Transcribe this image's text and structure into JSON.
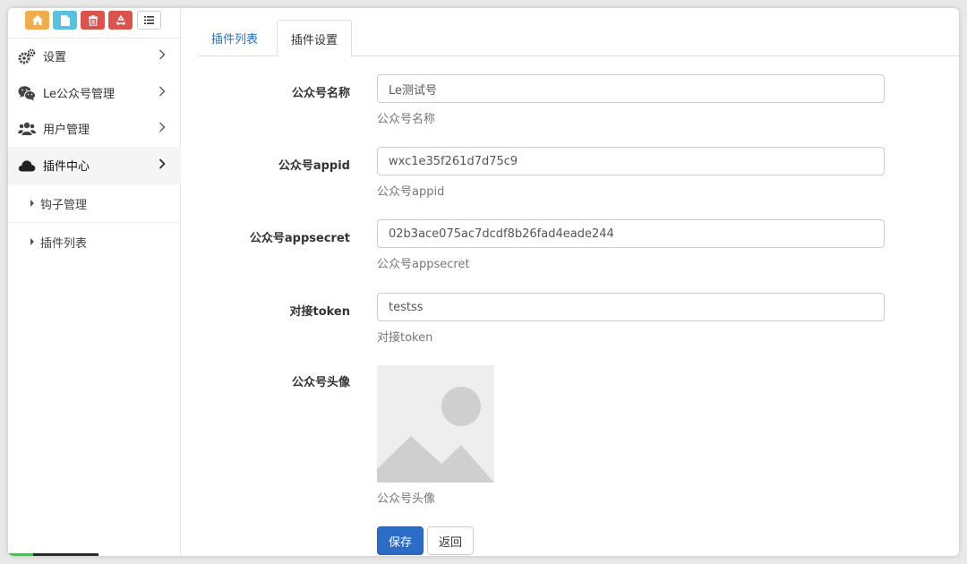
{
  "toolbar": {
    "buttons": [
      {
        "icon": "home-icon",
        "color": "#f0ad4e"
      },
      {
        "icon": "file-icon",
        "color": "#5bc0de"
      },
      {
        "icon": "trash-icon",
        "color": "#d9534f"
      },
      {
        "icon": "recycle-icon",
        "color": "#d9534f"
      },
      {
        "icon": "list-icon",
        "color": "#ffffff"
      }
    ]
  },
  "sidebar": {
    "items": [
      {
        "label": "设置",
        "icon": "gears-icon"
      },
      {
        "label": "Le公众号管理",
        "icon": "wechat-icon"
      },
      {
        "label": "用户管理",
        "icon": "users-icon"
      },
      {
        "label": "插件中心",
        "icon": "cloud-icon",
        "active": true
      }
    ],
    "sub_items": [
      {
        "label": "钩子管理"
      },
      {
        "label": "插件列表"
      }
    ]
  },
  "tabs": [
    {
      "label": "插件列表",
      "active": false
    },
    {
      "label": "插件设置",
      "active": true
    }
  ],
  "form": {
    "name": {
      "label": "公众号名称",
      "value": "Le测试号",
      "help": "公众号名称"
    },
    "appid": {
      "label": "公众号appid",
      "value": "wxc1e35f261d7d75c9",
      "help": "公众号appid"
    },
    "appsecret": {
      "label": "公众号appsecret",
      "value": "02b3ace075ac7dcdf8b26fad4eade244",
      "help": "公众号appsecret"
    },
    "token": {
      "label": "对接token",
      "value": "testss",
      "help": "对接token"
    },
    "avatar": {
      "label": "公众号头像",
      "help": "公众号头像"
    }
  },
  "buttons": {
    "save": "保存",
    "back": "返回"
  },
  "colors": {
    "accent": "#2d6cc4",
    "link": "#2a6fc0"
  }
}
